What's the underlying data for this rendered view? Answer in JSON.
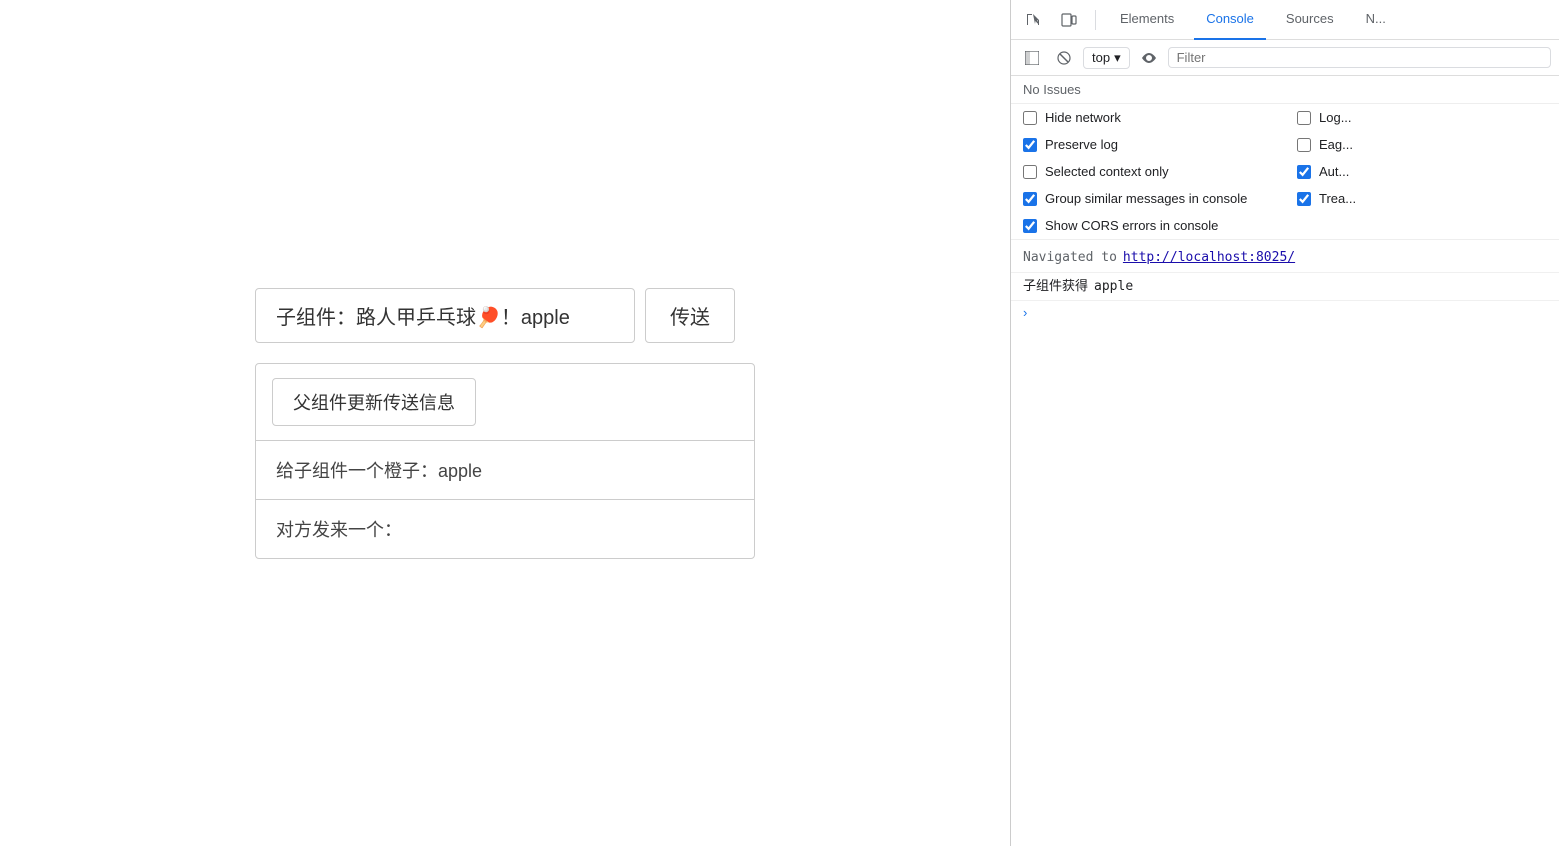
{
  "left": {
    "child_label": "子组件：",
    "child_input_value": "路人甲乒乓球🏓！apple",
    "send_button": "传送",
    "parent_update_button": "父组件更新传送信息",
    "parent_orange_label": "给子组件一个橙子：",
    "parent_orange_value": "apple",
    "parent_receive_label": "对方发来一个："
  },
  "devtools": {
    "tabs": [
      {
        "label": "Elements",
        "active": false
      },
      {
        "label": "Console",
        "active": true
      },
      {
        "label": "Sources",
        "active": false
      },
      {
        "label": "N...",
        "active": false
      }
    ],
    "toolbar": {
      "top_label": "top",
      "filter_placeholder": "Filter"
    },
    "no_issues": "No Issues",
    "checkboxes": [
      {
        "label": "Hide network",
        "checked": false
      },
      {
        "label": "Log...",
        "checked": false
      },
      {
        "label": "Preserve log",
        "checked": true
      },
      {
        "label": "Eag...",
        "checked": false
      },
      {
        "label": "Selected context only",
        "checked": false
      },
      {
        "label": "Aut...",
        "checked": true
      },
      {
        "label": "Group similar messages in console",
        "checked": true
      },
      {
        "label": "Trea...",
        "checked": true
      },
      {
        "label": "Show CORS errors in console",
        "checked": true
      }
    ],
    "console_lines": [
      {
        "type": "navigated",
        "text": "Navigated to ",
        "link": "http://localhost:8025/"
      },
      {
        "type": "log",
        "label": "子组件获得",
        "value": "apple"
      }
    ]
  }
}
